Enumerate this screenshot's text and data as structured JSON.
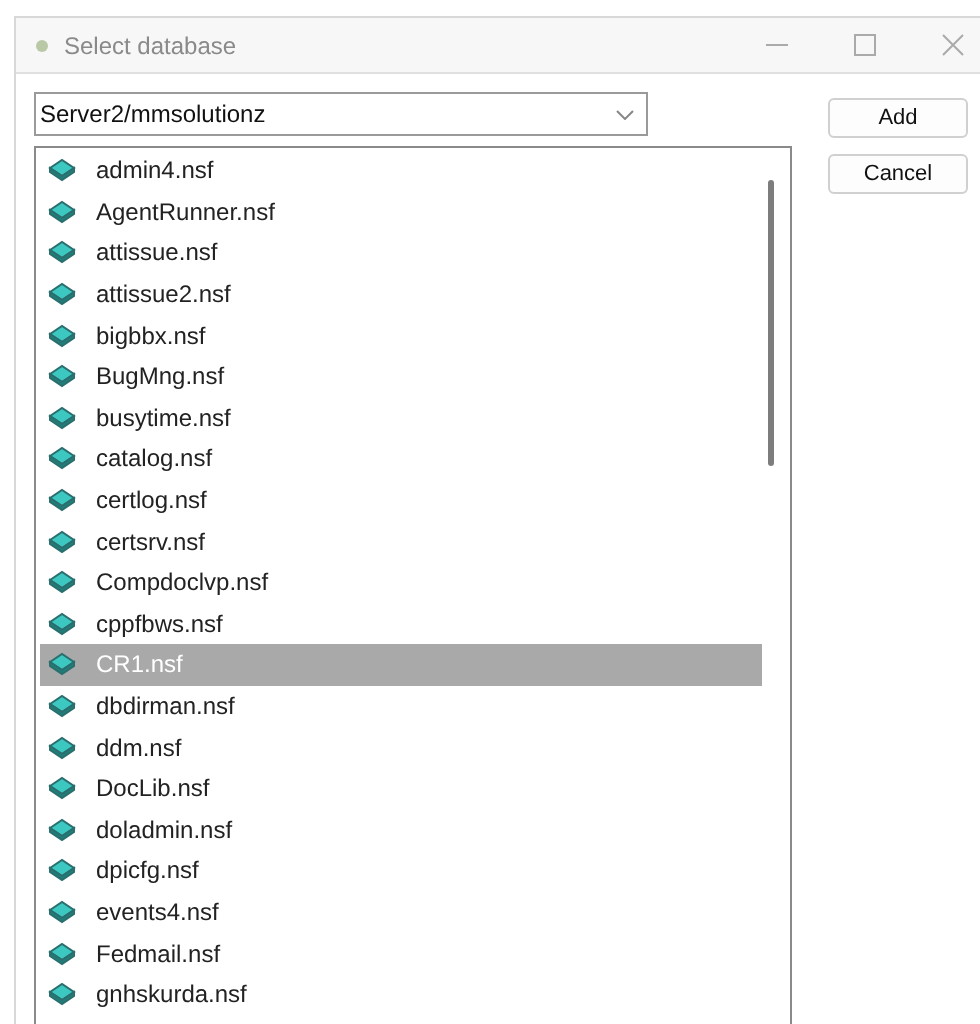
{
  "window": {
    "title": "Select database"
  },
  "server": {
    "value": "Server2/mmsolutionz"
  },
  "buttons": [
    "Add",
    "Cancel"
  ],
  "databases": [
    {
      "name": "admin4.nsf",
      "selected": false
    },
    {
      "name": "AgentRunner.nsf",
      "selected": false
    },
    {
      "name": "attissue.nsf",
      "selected": false
    },
    {
      "name": "attissue2.nsf",
      "selected": false
    },
    {
      "name": "bigbbx.nsf",
      "selected": false
    },
    {
      "name": "BugMng.nsf",
      "selected": false
    },
    {
      "name": "busytime.nsf",
      "selected": false
    },
    {
      "name": "catalog.nsf",
      "selected": false
    },
    {
      "name": "certlog.nsf",
      "selected": false
    },
    {
      "name": "certsrv.nsf",
      "selected": false
    },
    {
      "name": "Compdoclvp.nsf",
      "selected": false
    },
    {
      "name": "cppfbws.nsf",
      "selected": false
    },
    {
      "name": "CR1.nsf",
      "selected": true
    },
    {
      "name": "dbdirman.nsf",
      "selected": false
    },
    {
      "name": "ddm.nsf",
      "selected": false
    },
    {
      "name": "DocLib.nsf",
      "selected": false
    },
    {
      "name": "doladmin.nsf",
      "selected": false
    },
    {
      "name": "dpicfg.nsf",
      "selected": false
    },
    {
      "name": "events4.nsf",
      "selected": false
    },
    {
      "name": "Fedmail.nsf",
      "selected": false
    },
    {
      "name": "gnhskurda.nsf",
      "selected": false
    }
  ]
}
